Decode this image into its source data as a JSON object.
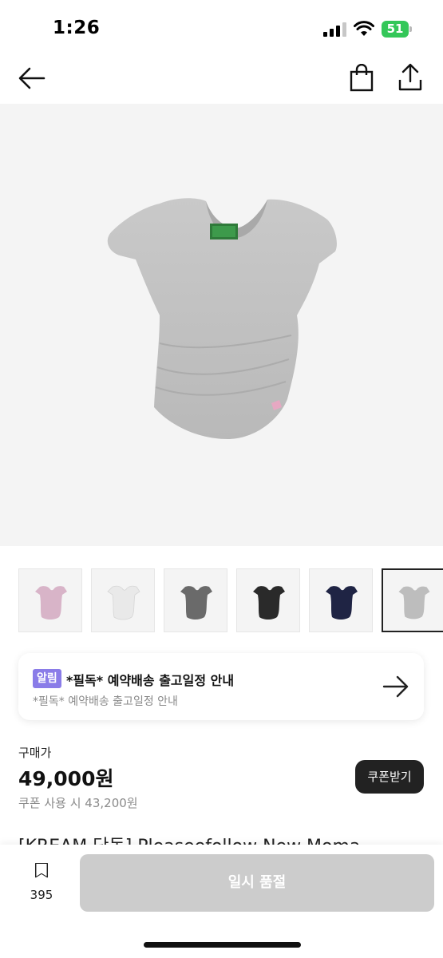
{
  "status_bar": {
    "time": "1:26",
    "battery": "51",
    "icons": [
      "signal-icon",
      "wifi-icon",
      "battery-icon"
    ]
  },
  "header": {
    "icons": [
      "back-arrow-icon",
      "shopping-bag-icon",
      "share-icon"
    ]
  },
  "product": {
    "main_image": "gray-scoop-neck-tshirt",
    "thumbnails": [
      {
        "color": "pink",
        "hex": "#d8b4c8",
        "selected": false
      },
      {
        "color": "white",
        "hex": "#ececec",
        "selected": false
      },
      {
        "color": "charcoal",
        "hex": "#6a6a6a",
        "selected": false
      },
      {
        "color": "black",
        "hex": "#2a2a2a",
        "selected": false
      },
      {
        "color": "navy",
        "hex": "#1f2444",
        "selected": false
      },
      {
        "color": "gray",
        "hex": "#bdbdbd",
        "selected": true
      }
    ]
  },
  "notice": {
    "tag": "알림",
    "title": "*필독* 예약배송 출고일정 안내",
    "subtitle": "*필독* 예약배송 출고일정 안내"
  },
  "price": {
    "label": "구매가",
    "value": "49,000원",
    "coupon_text": "쿠폰 사용 시 43,200원",
    "coupon_button": "쿠폰받기"
  },
  "title_peek": "[KREAM 단독] Pleaseefollow New Moma",
  "bottom_bar": {
    "bookmark_count": "395",
    "soldout_label": "일시 품절"
  },
  "colors": {
    "accent_tag": "#8a7ce8",
    "disabled_button": "#cccccc",
    "battery": "#34c759"
  }
}
